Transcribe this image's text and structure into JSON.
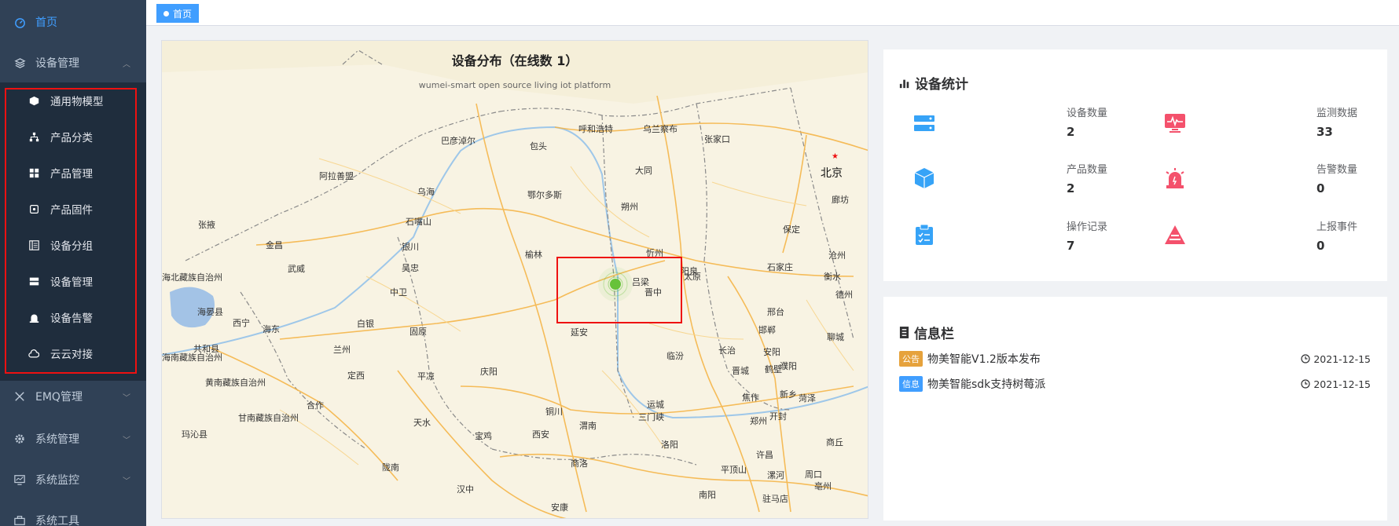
{
  "sidebar": {
    "home": "首页",
    "device_mgmt": "设备管理",
    "sub_items": [
      "通用物模型",
      "产品分类",
      "产品管理",
      "产品固件",
      "设备分组",
      "设备管理",
      "设备告警",
      "云云对接"
    ],
    "emq": "EMQ管理",
    "system": "系统管理",
    "monitor": "系统监控",
    "tools": "系统工具"
  },
  "tags": {
    "home": "首页"
  },
  "map": {
    "title": "设备分布（在线数 1）",
    "subtitle": "wumei-smart open source living iot platform",
    "cities": [
      {
        "name": "呼和浩特",
        "big": false
      },
      {
        "name": "乌兰察布",
        "big": false
      },
      {
        "name": "张家口",
        "big": false
      },
      {
        "name": "巴彦淖尔",
        "big": false
      },
      {
        "name": "包头",
        "big": false
      },
      {
        "name": "大同",
        "big": false
      },
      {
        "name": "北京",
        "big": true
      },
      {
        "name": "阿拉善盟",
        "big": false
      },
      {
        "name": "乌海",
        "big": false
      },
      {
        "name": "鄂尔多斯",
        "big": false
      },
      {
        "name": "朔州",
        "big": false
      },
      {
        "name": "廊坊",
        "big": false
      },
      {
        "name": "张掖",
        "big": false
      },
      {
        "name": "石嘴山",
        "big": false
      },
      {
        "name": "保定",
        "big": false
      },
      {
        "name": "金昌",
        "big": false
      },
      {
        "name": "银川",
        "big": false
      },
      {
        "name": "榆林",
        "big": false
      },
      {
        "name": "忻州",
        "big": false
      },
      {
        "name": "沧州",
        "big": false
      },
      {
        "name": "武威",
        "big": false
      },
      {
        "name": "吴忠",
        "big": false
      },
      {
        "name": "太原",
        "big": false
      },
      {
        "name": "阳泉",
        "big": false
      },
      {
        "name": "石家庄",
        "big": false
      },
      {
        "name": "海北藏族自治州",
        "big": false
      },
      {
        "name": "吕梁",
        "big": false
      },
      {
        "name": "衡水",
        "big": false
      },
      {
        "name": "中卫",
        "big": false
      },
      {
        "name": "晋中",
        "big": false
      },
      {
        "name": "德州",
        "big": false
      },
      {
        "name": "海晏县",
        "big": false
      },
      {
        "name": "西宁",
        "big": false
      },
      {
        "name": "白银",
        "big": false
      },
      {
        "name": "海东",
        "big": false
      },
      {
        "name": "邢台",
        "big": false
      },
      {
        "name": "固原",
        "big": false
      },
      {
        "name": "延安",
        "big": false
      },
      {
        "name": "邯郸",
        "big": false
      },
      {
        "name": "聊城",
        "big": false
      },
      {
        "name": "共和县",
        "big": false
      },
      {
        "name": "兰州",
        "big": false
      },
      {
        "name": "海南藏族自治州",
        "big": false
      },
      {
        "name": "黄南藏族自治州",
        "big": false
      },
      {
        "name": "临汾",
        "big": false
      },
      {
        "name": "长治",
        "big": false
      },
      {
        "name": "安阳",
        "big": false
      },
      {
        "name": "庆阳",
        "big": false
      },
      {
        "name": "鹤壁",
        "big": false
      },
      {
        "name": "濮阳",
        "big": false
      },
      {
        "name": "定西",
        "big": false
      },
      {
        "name": "平凉",
        "big": false
      },
      {
        "name": "晋城",
        "big": false
      },
      {
        "name": "焦作",
        "big": false
      },
      {
        "name": "新乡",
        "big": false
      },
      {
        "name": "菏泽",
        "big": false
      },
      {
        "name": "运城",
        "big": false
      },
      {
        "name": "合作",
        "big": false
      },
      {
        "name": "甘南藏族自治州",
        "big": false
      },
      {
        "name": "铜川",
        "big": false
      },
      {
        "name": "三门峡",
        "big": false
      },
      {
        "name": "天水",
        "big": false
      },
      {
        "name": "渭南",
        "big": false
      },
      {
        "name": "郑州",
        "big": false
      },
      {
        "name": "开封",
        "big": false
      },
      {
        "name": "玛沁县",
        "big": false
      },
      {
        "name": "宝鸡",
        "big": false
      },
      {
        "name": "西安",
        "big": false
      },
      {
        "name": "洛阳",
        "big": false
      },
      {
        "name": "商丘",
        "big": false
      },
      {
        "name": "许昌",
        "big": false
      },
      {
        "name": "陇南",
        "big": false
      },
      {
        "name": "商洛",
        "big": false
      },
      {
        "name": "平顶山",
        "big": false
      },
      {
        "name": "漯河",
        "big": false
      },
      {
        "name": "周口",
        "big": false
      },
      {
        "name": "亳州",
        "big": false
      },
      {
        "name": "汉中",
        "big": false
      },
      {
        "name": "南阳",
        "big": false
      },
      {
        "name": "驻马店",
        "big": false
      },
      {
        "name": "安康",
        "big": false
      }
    ]
  },
  "stats": {
    "title": "设备统计",
    "items": [
      {
        "label": "设备数量",
        "value": "2"
      },
      {
        "label": "监测数据",
        "value": "33"
      },
      {
        "label": "产品数量",
        "value": "2"
      },
      {
        "label": "告警数量",
        "value": "0"
      },
      {
        "label": "操作记录",
        "value": "7"
      },
      {
        "label": "上报事件",
        "value": "0"
      }
    ],
    "colors": {
      "blue": "#36a3f7",
      "red": "#f4516c"
    }
  },
  "news": {
    "title": "信息栏",
    "items": [
      {
        "tag": "公告",
        "tag_color": "#e6a23c",
        "text": "物美智能V1.2版本发布",
        "date": "2021-12-15"
      },
      {
        "tag": "信息",
        "tag_color": "#409eff",
        "text": "物美智能sdk支持树莓派",
        "date": "2021-12-15"
      }
    ]
  }
}
